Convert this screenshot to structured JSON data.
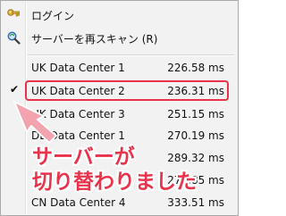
{
  "menu": {
    "login_label": "ログイン",
    "rescan_label": "サーバーを再スキャン (R)",
    "servers": [
      {
        "name": "UK Data Center 1",
        "ping": "226.58 ms",
        "checked": false
      },
      {
        "name": "UK Data Center 2",
        "ping": "236.31 ms",
        "checked": true
      },
      {
        "name": "UK Data Center 3",
        "ping": "251.15 ms",
        "checked": false
      },
      {
        "name": "DE Data Center 1",
        "ping": "270.19 ms",
        "checked": false
      },
      {
        "name": "",
        "ping": "289.32 ms",
        "checked": false
      },
      {
        "name": "",
        "ping": "271.85 ms",
        "checked": false
      },
      {
        "name": "CN Data Center 4",
        "ping": "333.51 ms",
        "checked": false
      }
    ],
    "check_glyph": "✔"
  },
  "annotation": {
    "line1": "サーバーが",
    "line2": "切り替わりました",
    "color": "#e8334a"
  },
  "icons": {
    "login": "key-icon",
    "rescan": "search-refresh-icon"
  }
}
